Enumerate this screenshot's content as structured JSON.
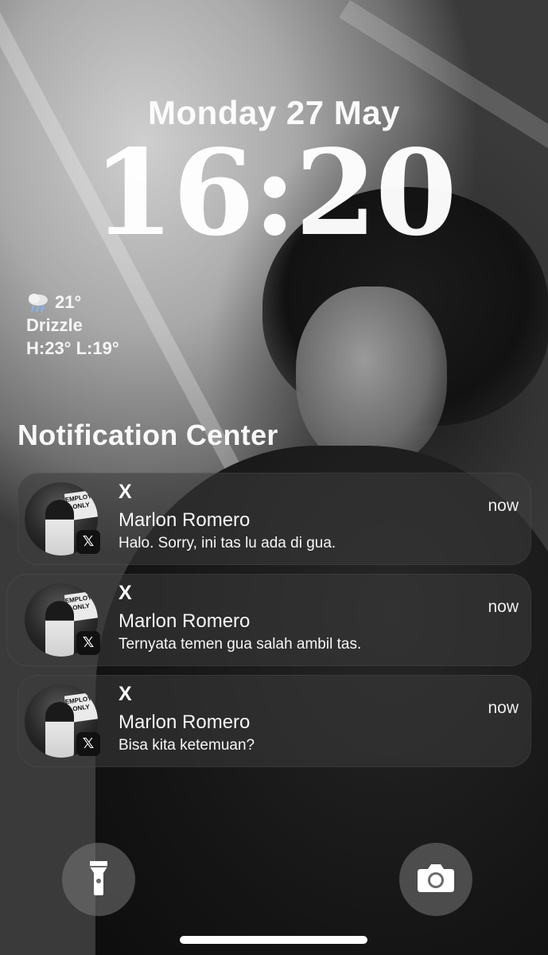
{
  "lockscreen": {
    "date": "Monday 27 May",
    "time": "16:20"
  },
  "weather": {
    "icon": "rain-cloud-icon",
    "temperature": "21°",
    "condition": "Drizzle",
    "high_low": "H:23° L:19°"
  },
  "notification_center": {
    "title": "Notification Center",
    "notifications": [
      {
        "app": "X",
        "sender": "Marlon Romero",
        "message": "Halo. Sorry, ini tas lu ada di gua.",
        "time": "now"
      },
      {
        "app": "X",
        "sender": "Marlon Romero",
        "message": "Ternyata temen gua salah ambil tas.",
        "time": "now"
      },
      {
        "app": "X",
        "sender": "Marlon Romero",
        "message": "Bisa kita ketemuan?",
        "time": "now"
      }
    ],
    "avatar_sign_text": "EMPLOYEES ONLY",
    "app_badge_glyph": "𝕏"
  },
  "quick_actions": {
    "left": "flashlight-icon",
    "right": "camera-icon"
  }
}
